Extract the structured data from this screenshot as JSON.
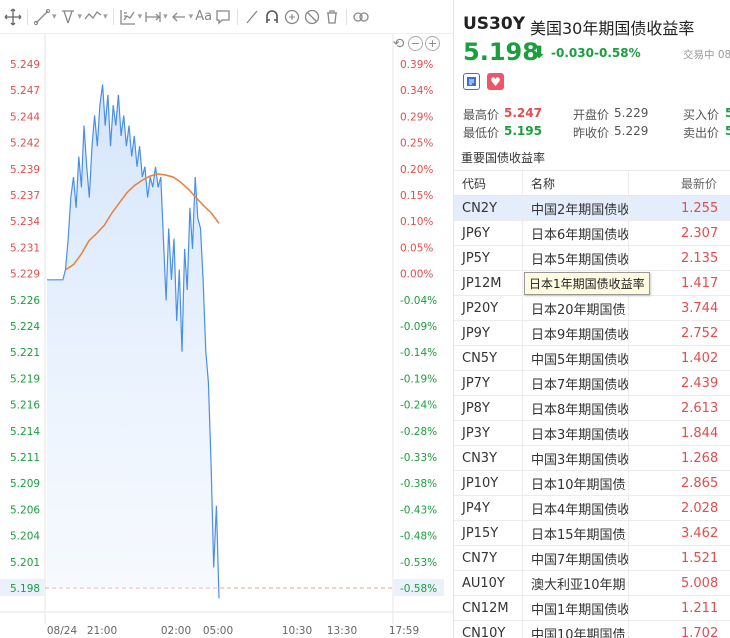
{
  "toolbar": {
    "text_tool": "Aa",
    "icons": [
      "crosshair-icon",
      "line-tool-icon",
      "pitchfork-icon",
      "measure-icon",
      "fib-icon",
      "range-icon",
      "arrow-left-icon",
      "text-icon",
      "comment-icon",
      "ruler-icon",
      "magnet-icon",
      "lock-icon",
      "hide-icon",
      "trash-icon",
      "link-icon"
    ]
  },
  "chart_data": {
    "type": "area",
    "left_ticks": [
      "5.249",
      "5.247",
      "5.244",
      "5.242",
      "5.239",
      "5.237",
      "5.234",
      "5.231",
      "5.229",
      "5.226",
      "5.224",
      "5.221",
      "5.219",
      "5.216",
      "5.214",
      "5.211",
      "5.209",
      "5.206",
      "5.204",
      "5.201",
      "5.198"
    ],
    "right_ticks": [
      "0.39%",
      "0.34%",
      "0.29%",
      "0.25%",
      "0.20%",
      "0.15%",
      "0.10%",
      "0.05%",
      "0.00%",
      "-0.04%",
      "-0.09%",
      "-0.14%",
      "-0.19%",
      "-0.24%",
      "-0.28%",
      "-0.33%",
      "-0.38%",
      "-0.43%",
      "-0.48%",
      "-0.53%",
      "-0.58%"
    ],
    "x_ticks": [
      "08/24",
      "21:00",
      "02:00",
      "05:00",
      "10:30",
      "13:30",
      "17:59"
    ],
    "ylim": [
      5.198,
      5.249
    ],
    "baseline": 5.229,
    "current": 5.198,
    "series": [
      {
        "values": [
          5.228,
          5.228,
          5.228,
          5.228,
          5.228,
          5.228,
          5.228,
          5.229,
          5.232,
          5.236,
          5.238,
          5.235,
          5.24,
          5.237,
          5.243,
          5.239,
          5.236,
          5.241,
          5.244,
          5.241,
          5.245,
          5.247,
          5.243,
          5.246,
          5.241,
          5.245,
          5.243,
          5.246,
          5.242,
          5.244,
          5.241,
          5.243,
          5.24,
          5.242,
          5.239,
          5.241,
          5.238,
          5.239,
          5.236,
          5.238,
          5.237,
          5.239,
          5.237,
          5.238,
          5.232,
          5.226,
          5.233,
          5.228,
          5.232,
          5.224,
          5.229,
          5.221,
          5.231,
          5.227,
          5.235,
          5.231,
          5.238,
          5.234,
          5.233,
          5.228,
          5.221,
          5.218,
          5.21,
          5.2,
          5.206,
          5.197
        ]
      },
      {
        "values": [
          5.229,
          5.2295,
          5.2305,
          5.2318,
          5.2325,
          5.2333,
          5.2345,
          5.2355,
          5.2365,
          5.2372,
          5.2377,
          5.2381,
          5.2383,
          5.2382,
          5.238,
          5.2375,
          5.2368,
          5.236,
          5.2352,
          5.2345,
          5.2335
        ]
      }
    ]
  },
  "quote": {
    "symbol": "US30Y",
    "name": "美国30年期国债收益率",
    "price": "5.198",
    "change": "-0.030",
    "change_pct": "-0.58%",
    "status": "交易中 08/",
    "high_label": "最高价",
    "high": "5.247",
    "low_label": "最低价",
    "low": "5.195",
    "open_label": "开盘价",
    "open": "5.229",
    "prev_label": "昨收价",
    "prev": "5.229",
    "bid_label": "买入价",
    "bid": "5",
    "ask_label": "卖出价",
    "ask": "5"
  },
  "bonds": {
    "title": "重要国债收益率",
    "headers": {
      "code": "代码",
      "name": "名称",
      "price": "最新价"
    },
    "tooltip": "日本1年期国债收益率",
    "rows": [
      {
        "code": "CN2Y",
        "name": "中国2年期国债收",
        "price": "1.255"
      },
      {
        "code": "JP6Y",
        "name": "日本6年期国债收",
        "price": "2.307"
      },
      {
        "code": "JP5Y",
        "name": "日本5年期国债收",
        "price": "2.135"
      },
      {
        "code": "JP12M",
        "name": "日本1年期国债收",
        "price": "1.417"
      },
      {
        "code": "JP20Y",
        "name": "日本20年期国债",
        "price": "3.744"
      },
      {
        "code": "JP9Y",
        "name": "日本9年期国债收",
        "price": "2.752"
      },
      {
        "code": "CN5Y",
        "name": "中国5年期国债收",
        "price": "1.402"
      },
      {
        "code": "JP7Y",
        "name": "日本7年期国债收",
        "price": "2.439"
      },
      {
        "code": "JP8Y",
        "name": "日本8年期国债收",
        "price": "2.613"
      },
      {
        "code": "JP3Y",
        "name": "日本3年期国债收",
        "price": "1.844"
      },
      {
        "code": "CN3Y",
        "name": "中国3年期国债收",
        "price": "1.268"
      },
      {
        "code": "JP10Y",
        "name": "日本10年期国债",
        "price": "2.865"
      },
      {
        "code": "JP4Y",
        "name": "日本4年期国债收",
        "price": "2.028"
      },
      {
        "code": "JP15Y",
        "name": "日本15年期国债",
        "price": "3.462"
      },
      {
        "code": "CN7Y",
        "name": "中国7年期国债收",
        "price": "1.521"
      },
      {
        "code": "AU10Y",
        "name": "澳大利亚10年期",
        "price": "5.008"
      },
      {
        "code": "CN12M",
        "name": "中国1年期国债收",
        "price": "1.211"
      },
      {
        "code": "CN10Y",
        "name": "中国10年期国债",
        "price": "1.702"
      }
    ]
  },
  "colors": {
    "up": "#e04e4e",
    "down": "#1a9e3e",
    "line": "#4a90e2",
    "ma": "#e8803a"
  }
}
